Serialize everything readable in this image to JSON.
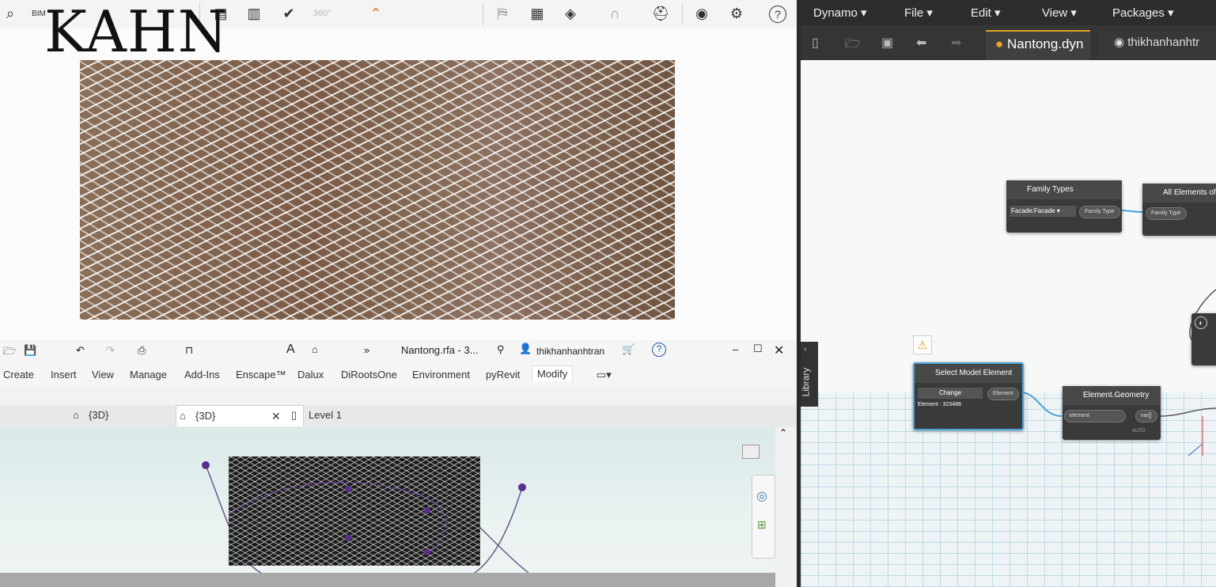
{
  "revit_top": {
    "logo": "KAHN",
    "toolbar_icons": [
      "scan-icon",
      "bim-icon",
      "chart-export-icon",
      "chart-arrow-icon",
      "circle-check-icon",
      "360-icon",
      "chevron-up-icon",
      "map-icon",
      "table-icon",
      "cube-icon",
      "dual-arch-icon",
      "helmet-icon",
      "eye-icon",
      "gear-icon",
      "help-icon"
    ]
  },
  "revit_window": {
    "title": "Nantong.rfa - 3...",
    "user": "thikhanhanhtran",
    "ribbon_tabs": [
      "Create",
      "Insert",
      "View",
      "Manage",
      "Add-Ins",
      "Enscape™",
      "Dalux",
      "DiRootsOne",
      "Environment",
      "pyRevit",
      "Modify"
    ],
    "active_ribbon_tab": "Modify",
    "view_tabs": [
      "{3D}",
      "{3D}",
      "Level 1"
    ],
    "active_view_tab": 1
  },
  "dynamo": {
    "menu": [
      "Dynamo",
      "File",
      "Edit",
      "View",
      "Packages"
    ],
    "tab_file": "Nantong.dyn",
    "tab_user": "thikhanhanhtr",
    "library_label": "Library",
    "nodes": {
      "family_types": {
        "title": "Family Types",
        "dropdown": "Facade:Facade",
        "output": "Family Type"
      },
      "all_elements": {
        "title": "All Elements of",
        "input": "Family Type"
      },
      "select_model": {
        "title": "Select Model Element",
        "button": "Change",
        "output": "Element",
        "info": "Element : 323488"
      },
      "element_geometry": {
        "title": "Element.Geometry",
        "input": "element",
        "output": "var[]",
        "lacing": "AUTO"
      }
    }
  }
}
